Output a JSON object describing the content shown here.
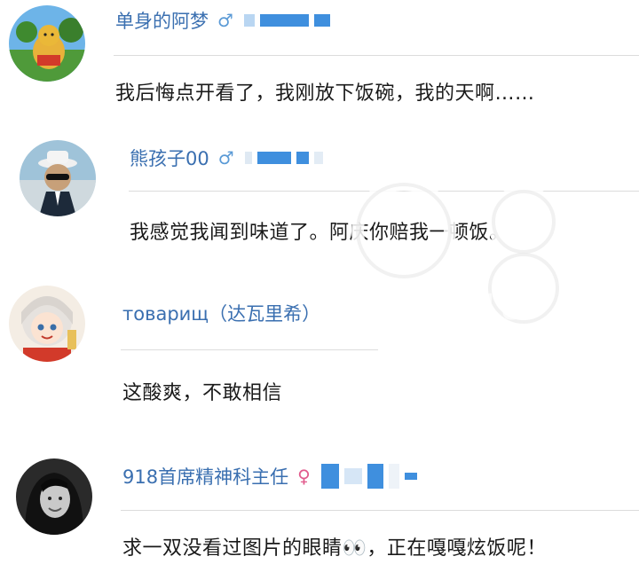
{
  "comments": [
    {
      "username": "单身的阿梦",
      "gender": "♂",
      "content": "我后悔点开看了，我刚放下饭碗，我的天啊……"
    },
    {
      "username": "熊孩子00",
      "gender": "♂",
      "content": "我感觉我闻到味道了。阿庆你赔我一顿饭。"
    },
    {
      "username": "товарищ（达瓦里希）",
      "gender": "",
      "content": "这酸爽，不敢相信"
    },
    {
      "username": "918首席精神科主任",
      "gender": "♀",
      "content": "求一双没看过图片的眼睛👀，正在嘎嘎炫饭呢！"
    }
  ],
  "colors": {
    "username": "#3a6fb0",
    "male": "#5a9ad6",
    "female": "#e15a8c",
    "level_bar": "#3f8fde"
  },
  "watermark": {
    "text": "918"
  }
}
